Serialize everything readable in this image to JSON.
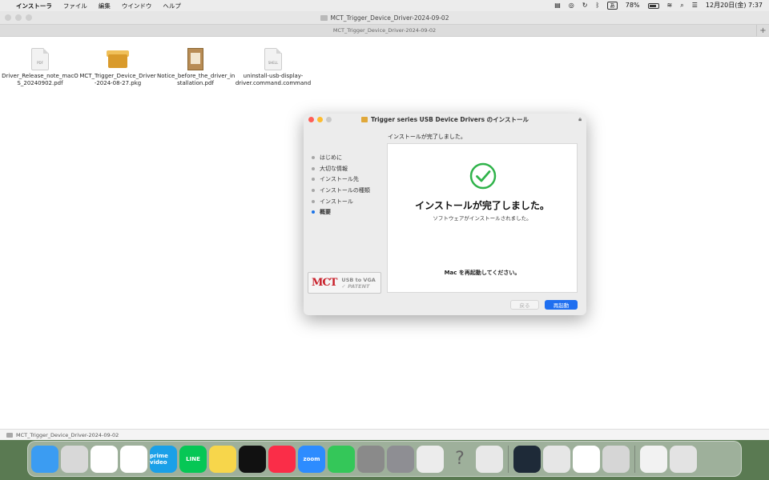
{
  "menubar": {
    "apple": "",
    "app_name": "インストーラ",
    "items": [
      "ファイル",
      "編集",
      "ウインドウ",
      "ヘルプ"
    ],
    "input_mode": "あ",
    "battery": "78%",
    "datetime": "12月20日(金)  7:37"
  },
  "finder": {
    "window_title": "MCT_Trigger_Device_Driver-2024-09-02",
    "tab_title": "MCT_Trigger_Device_Driver-2024-09-02",
    "status_path": "MCT_Trigger_Device_Driver-2024-09-02",
    "files": [
      {
        "name_line1": "Driver_Release_note_macO",
        "name_line2": "S_20240902.pdf",
        "icon": "pdf-doc-icon",
        "badge": "PDF"
      },
      {
        "name_line1": "MCT_Trigger_Device_Driver",
        "name_line2": "-2024-08-27.pkg",
        "icon": "package-icon",
        "badge": ""
      },
      {
        "name_line1": "Notice_before_the_driver_in",
        "name_line2": "stallation.pdf",
        "icon": "pdf-notebook-icon",
        "badge": ""
      },
      {
        "name_line1": "uninstall-usb-display-",
        "name_line2": "driver.command.command",
        "icon": "shell-script-icon",
        "badge": "SHELL"
      }
    ]
  },
  "installer": {
    "title": "Trigger series USB Device Drivers のインストール",
    "header": "インストールが完了しました。",
    "steps": [
      {
        "label": "はじめに",
        "active": false
      },
      {
        "label": "大切な情報",
        "active": false
      },
      {
        "label": "インストール先",
        "active": false
      },
      {
        "label": "インストールの種類",
        "active": false
      },
      {
        "label": "インストール",
        "active": false
      },
      {
        "label": "概要",
        "active": true
      }
    ],
    "logo": {
      "brand": "MCT",
      "line1": "USB to VGA",
      "line2": "PATENT"
    },
    "complete_heading": "インストールが完了しました。",
    "complete_sub": "ソフトウェアがインストールされました。",
    "restart_note": "Mac を再起動してください。",
    "back_button": "戻る",
    "restart_button": "再起動",
    "accent_color": "#1f6ff0",
    "success_color": "#2fb34a"
  },
  "dock": {
    "apps": [
      {
        "name": "finder",
        "color": "#3b9cf2",
        "label": ""
      },
      {
        "name": "launchpad",
        "color": "#d8d8d8",
        "label": ""
      },
      {
        "name": "chrome",
        "color": "#ffffff",
        "label": ""
      },
      {
        "name": "photos",
        "color": "#ffffff",
        "label": ""
      },
      {
        "name": "prime-video",
        "color": "#1aa0e8",
        "label": "prime video"
      },
      {
        "name": "line",
        "color": "#06c755",
        "label": "LINE"
      },
      {
        "name": "notes",
        "color": "#f7d64b",
        "label": ""
      },
      {
        "name": "clock",
        "color": "#111111",
        "label": ""
      },
      {
        "name": "music",
        "color": "#fa2d48",
        "label": ""
      },
      {
        "name": "zoom",
        "color": "#2d8cff",
        "label": "zoom"
      },
      {
        "name": "facetime",
        "color": "#34c759",
        "label": ""
      },
      {
        "name": "automator",
        "color": "#8a8a8a",
        "label": ""
      },
      {
        "name": "system-settings",
        "color": "#8e8e93",
        "label": ""
      },
      {
        "name": "calculator",
        "color": "#ececec",
        "label": ""
      },
      {
        "name": "help",
        "color": "transparent",
        "label": "?"
      },
      {
        "name": "iphone-mirroring",
        "color": "#e8e8e8",
        "label": ""
      }
    ],
    "apps_right": [
      {
        "name": "filmora",
        "color": "#1e2a38",
        "label": ""
      },
      {
        "name": "quicktime",
        "color": "#e6e6e6",
        "label": ""
      },
      {
        "name": "1password",
        "color": "#ffffff",
        "label": ""
      },
      {
        "name": "installer",
        "color": "#d6d6d6",
        "label": ""
      }
    ],
    "apps_trash": [
      {
        "name": "downloads-stack",
        "color": "#f2f2f2",
        "label": ""
      },
      {
        "name": "trash",
        "color": "#e3e3e3",
        "label": ""
      }
    ]
  }
}
